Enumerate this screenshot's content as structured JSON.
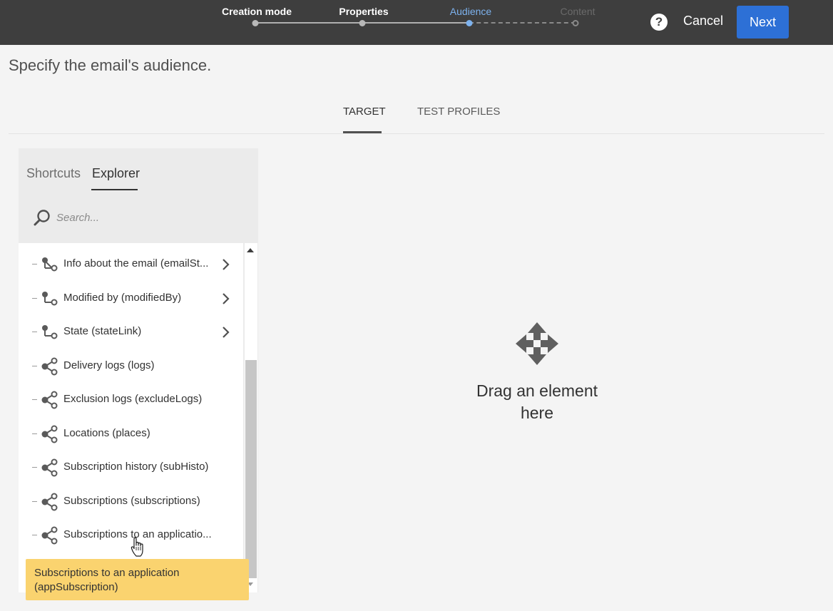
{
  "wizard": {
    "steps": [
      {
        "label": "Creation mode",
        "state": "done"
      },
      {
        "label": "Properties",
        "state": "done"
      },
      {
        "label": "Audience",
        "state": "active"
      },
      {
        "label": "Content",
        "state": "future"
      }
    ],
    "help_label": "?",
    "cancel_label": "Cancel",
    "next_label": "Next"
  },
  "page": {
    "title": "Specify the email's audience."
  },
  "tabs": [
    {
      "label": "TARGET",
      "active": true
    },
    {
      "label": "TEST PROFILES",
      "active": false
    }
  ],
  "panel": {
    "subtabs": [
      {
        "label": "Shortcuts",
        "active": false
      },
      {
        "label": "Explorer",
        "active": true
      }
    ],
    "search": {
      "placeholder": "Search...",
      "value": ""
    },
    "items": [
      {
        "label": "Info about the email (emailSt...",
        "icon": "link-icon",
        "expandable": true
      },
      {
        "label": "Modified by (modifiedBy)",
        "icon": "link-icon",
        "expandable": true
      },
      {
        "label": "State (stateLink)",
        "icon": "link-icon",
        "expandable": true
      },
      {
        "label": "Delivery logs (logs)",
        "icon": "collection-link-icon",
        "expandable": false
      },
      {
        "label": "Exclusion logs (excludeLogs)",
        "icon": "collection-link-icon",
        "expandable": false
      },
      {
        "label": "Locations (places)",
        "icon": "collection-link-icon",
        "expandable": false
      },
      {
        "label": "Subscription history (subHisto)",
        "icon": "collection-link-icon",
        "expandable": false
      },
      {
        "label": "Subscriptions (subscriptions)",
        "icon": "collection-link-icon",
        "expandable": false
      },
      {
        "label": "Subscriptions to an applicatio...",
        "icon": "collection-link-icon",
        "expandable": false
      }
    ],
    "tooltip": {
      "line1": "Subscriptions to an application",
      "line2": "(appSubscription)"
    }
  },
  "dropzone": {
    "icon": "move-icon",
    "line1": "Drag an element",
    "line2": "here"
  },
  "colors": {
    "topbar": "#3e3e3e",
    "accent": "#2d70d6",
    "active_step": "#7db2ee",
    "tooltip": "#fad36f"
  }
}
